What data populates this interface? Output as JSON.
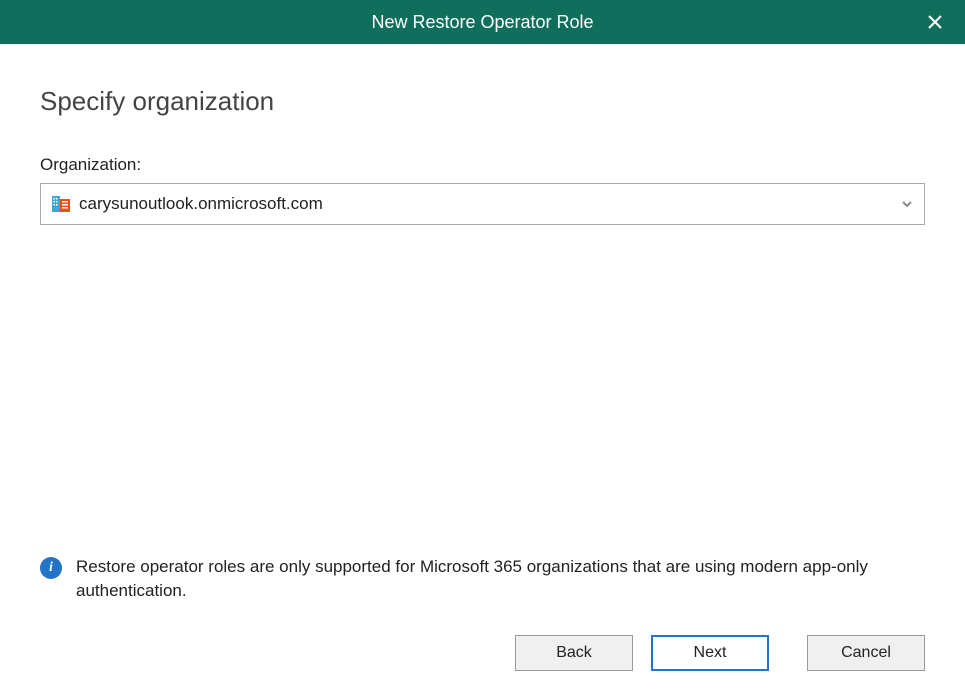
{
  "titlebar": {
    "title": "New Restore Operator Role"
  },
  "page": {
    "heading": "Specify organization"
  },
  "organization": {
    "label": "Organization:",
    "value": "carysunoutlook.onmicrosoft.com"
  },
  "info": {
    "text": "Restore operator roles are only supported for Microsoft 365 organizations that are using modern app-only authentication."
  },
  "buttons": {
    "back": "Back",
    "next": "Next",
    "cancel": "Cancel"
  }
}
